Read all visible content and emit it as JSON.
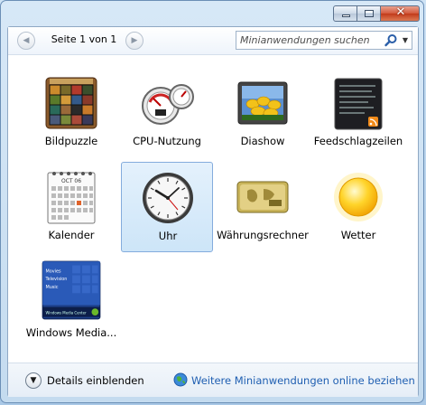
{
  "window": {
    "controls": {
      "minimize": "minimize",
      "maximize": "maximize",
      "close": "✕"
    }
  },
  "toolbar": {
    "page_label": "Seite 1 von 1",
    "search_placeholder": "Minianwendungen suchen",
    "prev_icon": "chevron-left-icon",
    "next_icon": "chevron-right-icon"
  },
  "gadgets": [
    {
      "label": "Bildpuzzle",
      "icon": "picture-puzzle-icon"
    },
    {
      "label": "CPU-Nutzung",
      "icon": "cpu-meter-icon"
    },
    {
      "label": "Diashow",
      "icon": "slideshow-icon"
    },
    {
      "label": "Feedschlagzeilen",
      "icon": "feed-headlines-icon"
    },
    {
      "label": "Kalender",
      "icon": "calendar-icon",
      "calendar_month": "OCT 06"
    },
    {
      "label": "Uhr",
      "icon": "clock-icon",
      "selected": true
    },
    {
      "label": "Währungsrechner",
      "icon": "currency-icon"
    },
    {
      "label": "Wetter",
      "icon": "weather-sun-icon"
    },
    {
      "label": "Windows Media...",
      "icon": "media-center-icon",
      "menu": [
        "Movies",
        "Television",
        "Music"
      ],
      "brand": "Windows Media Center"
    }
  ],
  "footer": {
    "details_label": "Details einblenden",
    "online_link": "Weitere Minianwendungen online beziehen"
  },
  "colors": {
    "link": "#1e5eb1",
    "selection": "#cde5f8"
  }
}
